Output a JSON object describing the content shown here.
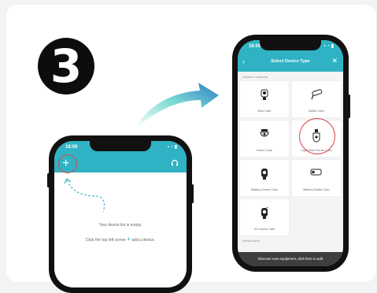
{
  "step": {
    "number": "3"
  },
  "colors": {
    "accent": "#2fb3c4",
    "highlight": "#d9484e",
    "badge": "#0d0d0d"
  },
  "phone_home": {
    "status": {
      "time": "18:09",
      "icons": "▪ ◔ ▮"
    },
    "add_icon": "+",
    "headset_icon": "headset-icon",
    "empty_line1": "Your device list is empty.",
    "empty_line2_prefix": "Click the top left corner",
    "empty_line2_plus": "+",
    "empty_line2_suffix": "add a device."
  },
  "phone_select": {
    "status": {
      "time": "18:09",
      "icons": "▪ ◔ ▮"
    },
    "back_icon": "‹",
    "title": "Select Device Type",
    "close_icon": "✕",
    "section_outdoor": "Outdoor Cameras",
    "section_second": "Second Arm",
    "devices": [
      {
        "label": "Mini Cam",
        "icon": "mini-cam-icon"
      },
      {
        "label": "Bullet Cam",
        "icon": "bullet-cam-icon"
      },
      {
        "label": "Dome Cam",
        "icon": "dome-cam-icon"
      },
      {
        "label": "Light Bulb Dome Cam",
        "icon": "bulb-cam-icon",
        "highlighted": true
      },
      {
        "label": "Battery Dome Cam",
        "icon": "battery-dome-cam-icon"
      },
      {
        "label": "Battery Bullet Cam",
        "icon": "battery-bullet-cam-icon"
      },
      {
        "label": "4G Dome Cam",
        "icon": "4g-dome-cam-icon"
      }
    ],
    "banner": "Discover new equipment, click here to add"
  }
}
